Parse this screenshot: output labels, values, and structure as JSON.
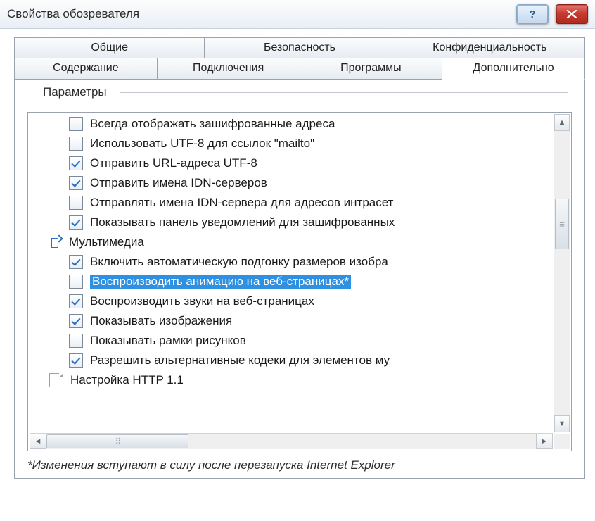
{
  "title": "Свойства обозревателя",
  "tabs_row1": [
    "Общие",
    "Безопасность",
    "Конфиденциальность"
  ],
  "tabs_row2": [
    "Содержание",
    "Подключения",
    "Программы",
    "Дополнительно"
  ],
  "active_tab": "Дополнительно",
  "group_label": "Параметры",
  "items": [
    {
      "checked": false,
      "label": "Всегда отображать зашифрованные адреса"
    },
    {
      "checked": false,
      "label": "Использовать UTF-8 для ссылок \"mailto\""
    },
    {
      "checked": true,
      "label": "Отправить URL-адреса UTF-8"
    },
    {
      "checked": true,
      "label": "Отправить имена IDN-серверов"
    },
    {
      "checked": false,
      "label": "Отправлять имена IDN-сервера для адресов интрасет"
    },
    {
      "checked": true,
      "label": "Показывать панель уведомлений для зашифрованных"
    },
    {
      "category": "media",
      "label": "Мультимедиа"
    },
    {
      "checked": true,
      "label": "Включить автоматическую подгонку размеров изобра"
    },
    {
      "checked": false,
      "label": "Воспроизводить анимацию на веб-страницах*",
      "selected": true
    },
    {
      "checked": true,
      "label": "Воспроизводить звуки на веб-страницах"
    },
    {
      "checked": true,
      "label": "Показывать изображения"
    },
    {
      "checked": false,
      "label": "Показывать рамки рисунков"
    },
    {
      "checked": true,
      "label": "Разрешить альтернативные кодеки для элементов му"
    },
    {
      "category": "page",
      "label": "Настройка HTTP 1.1"
    }
  ],
  "footnote": "*Изменения вступают в силу после перезапуска Internet Explorer"
}
